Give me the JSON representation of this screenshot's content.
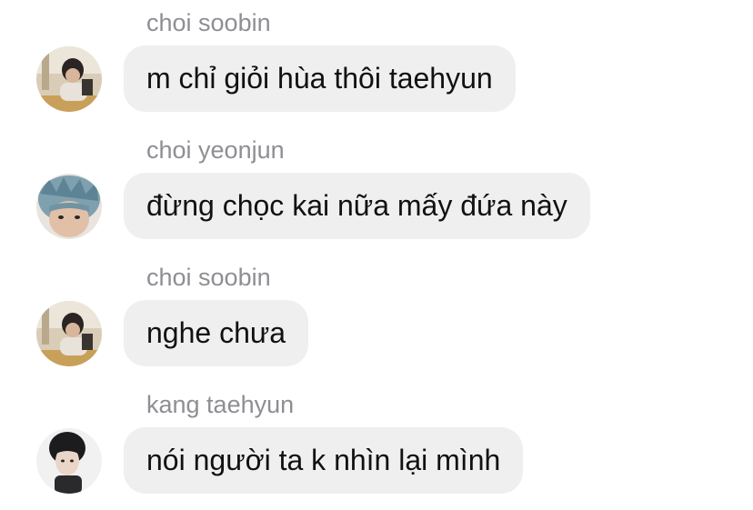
{
  "messages": [
    {
      "sender": "choi soobin",
      "text": "m chỉ giỏi hùa thôi taehyun",
      "avatar": "soobin-avatar"
    },
    {
      "sender": "choi yeonjun",
      "text": "đừng chọc kai nữa mấy đứa này",
      "avatar": "yeonjun-avatar"
    },
    {
      "sender": "choi soobin",
      "text": "nghe chưa",
      "avatar": "soobin-avatar"
    },
    {
      "sender": "kang taehyun",
      "text": "nói người ta k nhìn lại mình",
      "avatar": "taehyun-avatar"
    }
  ],
  "colors": {
    "bubble": "#efeff0",
    "sender_name": "#8e8e93",
    "message_text": "#111111"
  }
}
